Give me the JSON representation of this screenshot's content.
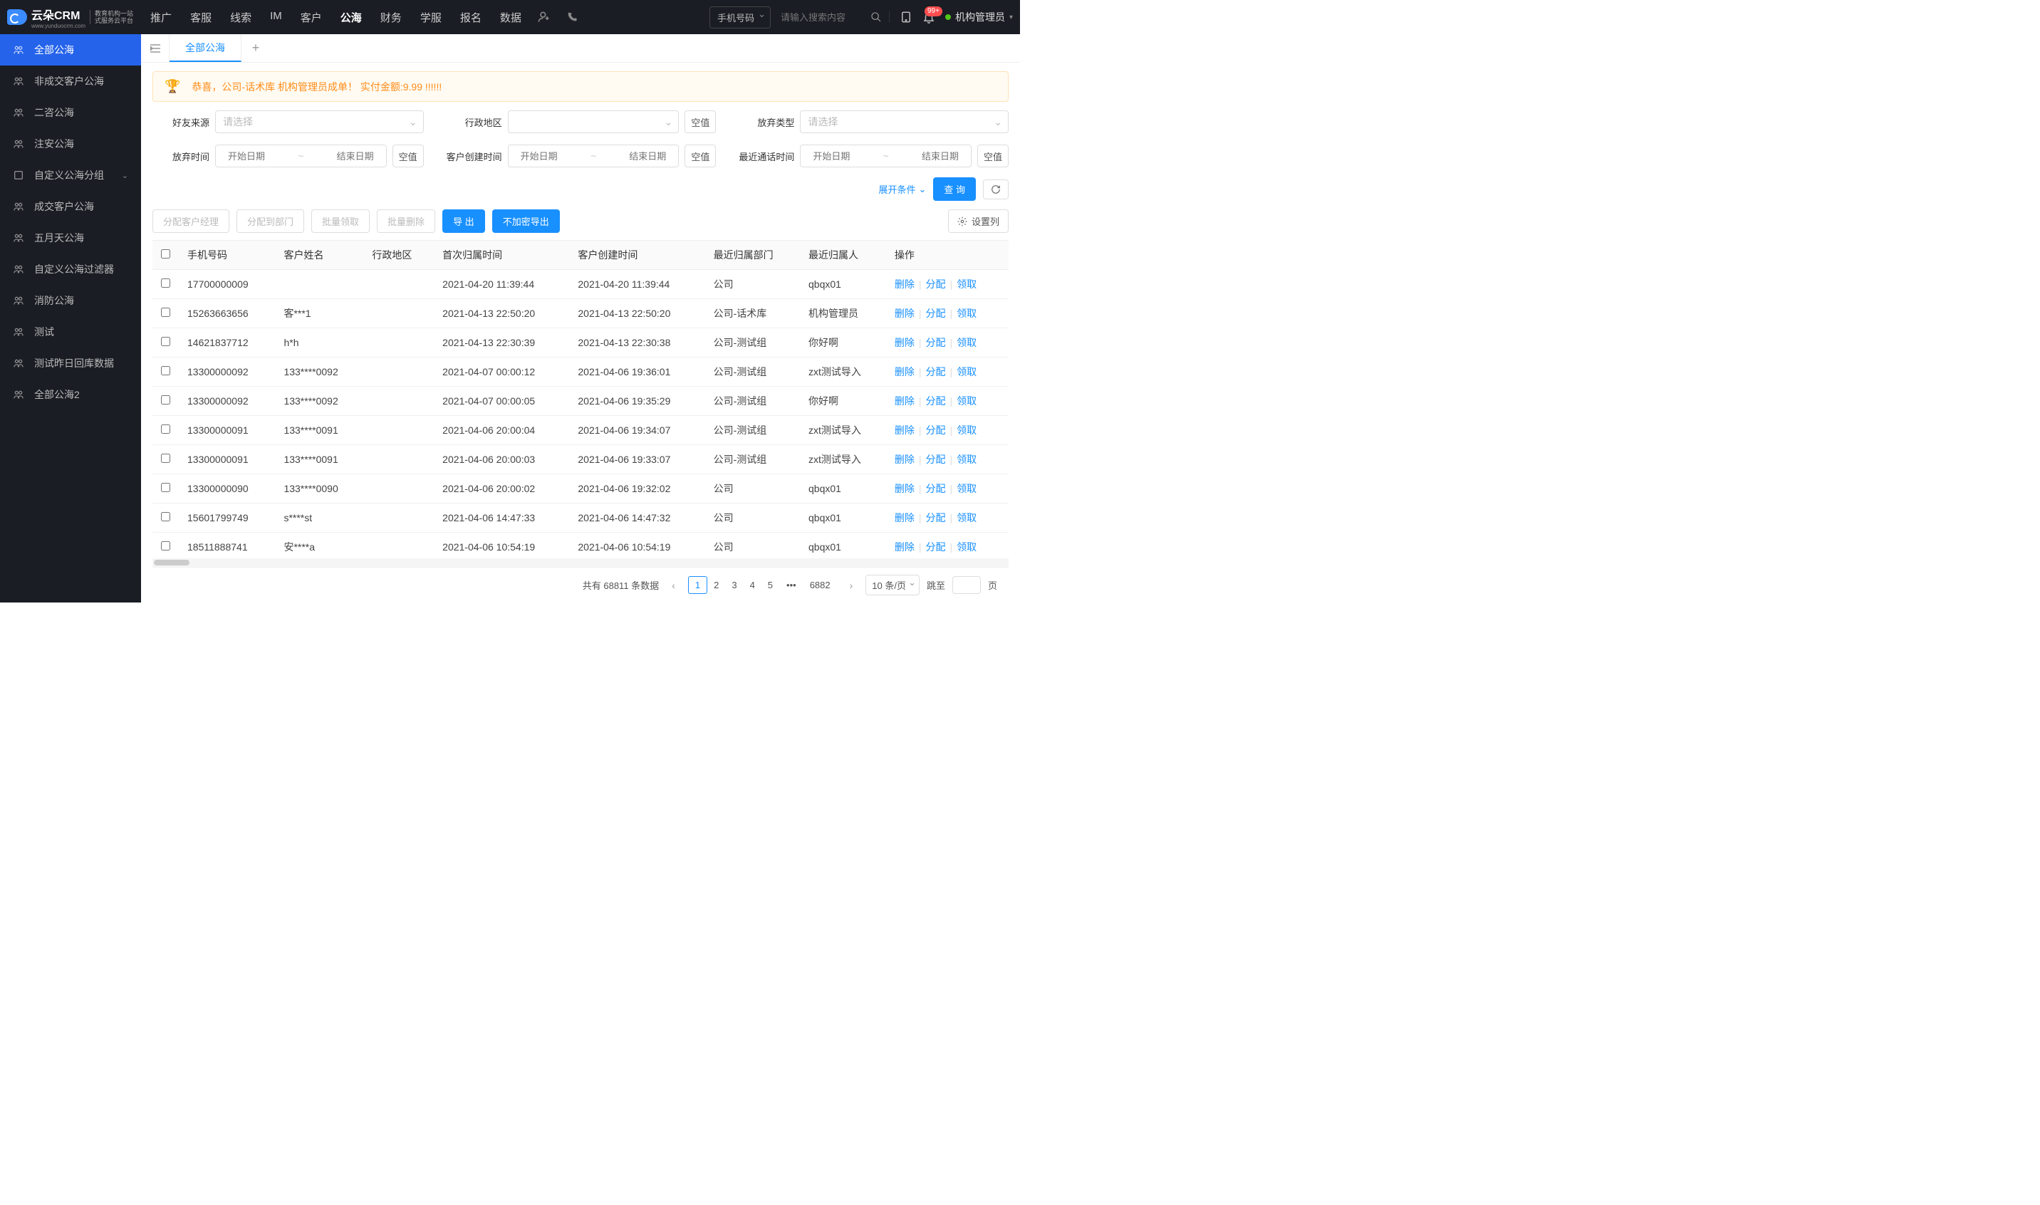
{
  "header": {
    "logo_main": "云朵CRM",
    "logo_sub1": "教育机构一站",
    "logo_sub2": "式服务云平台",
    "logo_url": "www.yunduocrm.com",
    "nav": [
      "推广",
      "客服",
      "线索",
      "IM",
      "客户",
      "公海",
      "财务",
      "学服",
      "报名",
      "数据"
    ],
    "nav_active_index": 5,
    "search_type": "手机号码",
    "search_placeholder": "请输入搜索内容",
    "notif_badge": "99+",
    "user_name": "机构管理员"
  },
  "sidebar": [
    {
      "label": "全部公海",
      "active": true
    },
    {
      "label": "非成交客户公海"
    },
    {
      "label": "二咨公海"
    },
    {
      "label": "注安公海"
    },
    {
      "label": "自定义公海分组",
      "expandable": true
    },
    {
      "label": "成交客户公海"
    },
    {
      "label": "五月天公海"
    },
    {
      "label": "自定义公海过滤器"
    },
    {
      "label": "消防公海"
    },
    {
      "label": "测试"
    },
    {
      "label": "测试昨日回库数据"
    },
    {
      "label": "全部公海2"
    }
  ],
  "tabs": {
    "active": "全部公海"
  },
  "banner": "恭喜，公司-话术库  机构管理员成单！  实付金额:9.99 !!!!!!",
  "filters": {
    "labels": {
      "source": "好友来源",
      "region": "行政地区",
      "abandon_type": "放弃类型",
      "abandon_time": "放弃时间",
      "create_time": "客户创建时间",
      "call_time": "最近通话时间"
    },
    "placeholder_select": "请选择",
    "placeholder_start": "开始日期",
    "placeholder_end": "结束日期",
    "null_btn": "空值"
  },
  "filter_actions": {
    "expand": "展开条件",
    "search": "查 询"
  },
  "toolbar": {
    "assign_mgr": "分配客户经理",
    "assign_dept": "分配到部门",
    "bulk_claim": "批量领取",
    "bulk_del": "批量删除",
    "export": "导 出",
    "export_plain": "不加密导出",
    "set_cols": "设置列"
  },
  "table": {
    "headers": [
      "手机号码",
      "客户姓名",
      "行政地区",
      "首次归属时间",
      "客户创建时间",
      "最近归属部门",
      "最近归属人",
      "操作"
    ],
    "ops": {
      "del": "删除",
      "assign": "分配",
      "claim": "领取"
    },
    "rows": [
      {
        "phone": "17700000009",
        "name": "",
        "region": "",
        "first": "2021-04-20 11:39:44",
        "created": "2021-04-20 11:39:44",
        "dept": "公司",
        "owner": "qbqx01"
      },
      {
        "phone": "15263663656",
        "name": "客***1",
        "region": "",
        "first": "2021-04-13 22:50:20",
        "created": "2021-04-13 22:50:20",
        "dept": "公司-话术库",
        "owner": "机构管理员"
      },
      {
        "phone": "14621837712",
        "name": "h*h",
        "region": "",
        "first": "2021-04-13 22:30:39",
        "created": "2021-04-13 22:30:38",
        "dept": "公司-测试组",
        "owner": "你好啊"
      },
      {
        "phone": "13300000092",
        "name": "133****0092",
        "region": "",
        "first": "2021-04-07 00:00:12",
        "created": "2021-04-06 19:36:01",
        "dept": "公司-测试组",
        "owner": "zxt测试导入"
      },
      {
        "phone": "13300000092",
        "name": "133****0092",
        "region": "",
        "first": "2021-04-07 00:00:05",
        "created": "2021-04-06 19:35:29",
        "dept": "公司-测试组",
        "owner": "你好啊"
      },
      {
        "phone": "13300000091",
        "name": "133****0091",
        "region": "",
        "first": "2021-04-06 20:00:04",
        "created": "2021-04-06 19:34:07",
        "dept": "公司-测试组",
        "owner": "zxt测试导入"
      },
      {
        "phone": "13300000091",
        "name": "133****0091",
        "region": "",
        "first": "2021-04-06 20:00:03",
        "created": "2021-04-06 19:33:07",
        "dept": "公司-测试组",
        "owner": "zxt测试导入"
      },
      {
        "phone": "13300000090",
        "name": "133****0090",
        "region": "",
        "first": "2021-04-06 20:00:02",
        "created": "2021-04-06 19:32:02",
        "dept": "公司",
        "owner": "qbqx01"
      },
      {
        "phone": "15601799749",
        "name": "s****st",
        "region": "",
        "first": "2021-04-06 14:47:33",
        "created": "2021-04-06 14:47:32",
        "dept": "公司",
        "owner": "qbqx01"
      },
      {
        "phone": "18511888741",
        "name": "安****a",
        "region": "",
        "first": "2021-04-06 10:54:19",
        "created": "2021-04-06 10:54:19",
        "dept": "公司",
        "owner": "qbqx01"
      }
    ]
  },
  "pager": {
    "total_prefix": "共有",
    "total": "68811",
    "total_suffix": "条数据",
    "pages": [
      "1",
      "2",
      "3",
      "4",
      "5"
    ],
    "active": 0,
    "last": "6882",
    "size": "10 条/页",
    "jump_lbl": "跳至",
    "page_suffix": "页"
  }
}
